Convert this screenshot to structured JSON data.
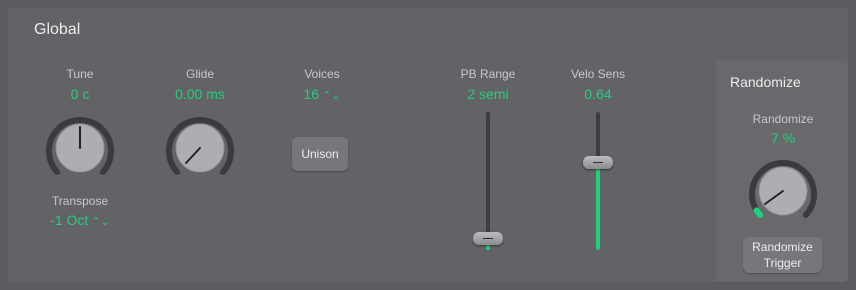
{
  "global": {
    "title": "Global"
  },
  "tune": {
    "label": "Tune",
    "value": "0 c"
  },
  "glide": {
    "label": "Glide",
    "value": "0.00 ms"
  },
  "voices": {
    "label": "Voices",
    "value": "16",
    "chevron": "⌃⌄"
  },
  "transpose": {
    "label": "Transpose",
    "value": "-1 Oct",
    "chevron": "⌃⌄"
  },
  "unison": {
    "label": "Unison"
  },
  "pb_range": {
    "label": "PB Range",
    "value": "2 semi",
    "level": 0.05
  },
  "velo_sens": {
    "label": "Velo Sens",
    "value": "0.64",
    "level": 0.64
  },
  "randomize": {
    "section_title": "Randomize",
    "label": "Randomize",
    "value": "7 %",
    "trigger_line1": "Randomize",
    "trigger_line2": "Trigger"
  },
  "colors": {
    "accent": "#21d07a",
    "background": "#5c5c60",
    "panel": "#636367"
  }
}
